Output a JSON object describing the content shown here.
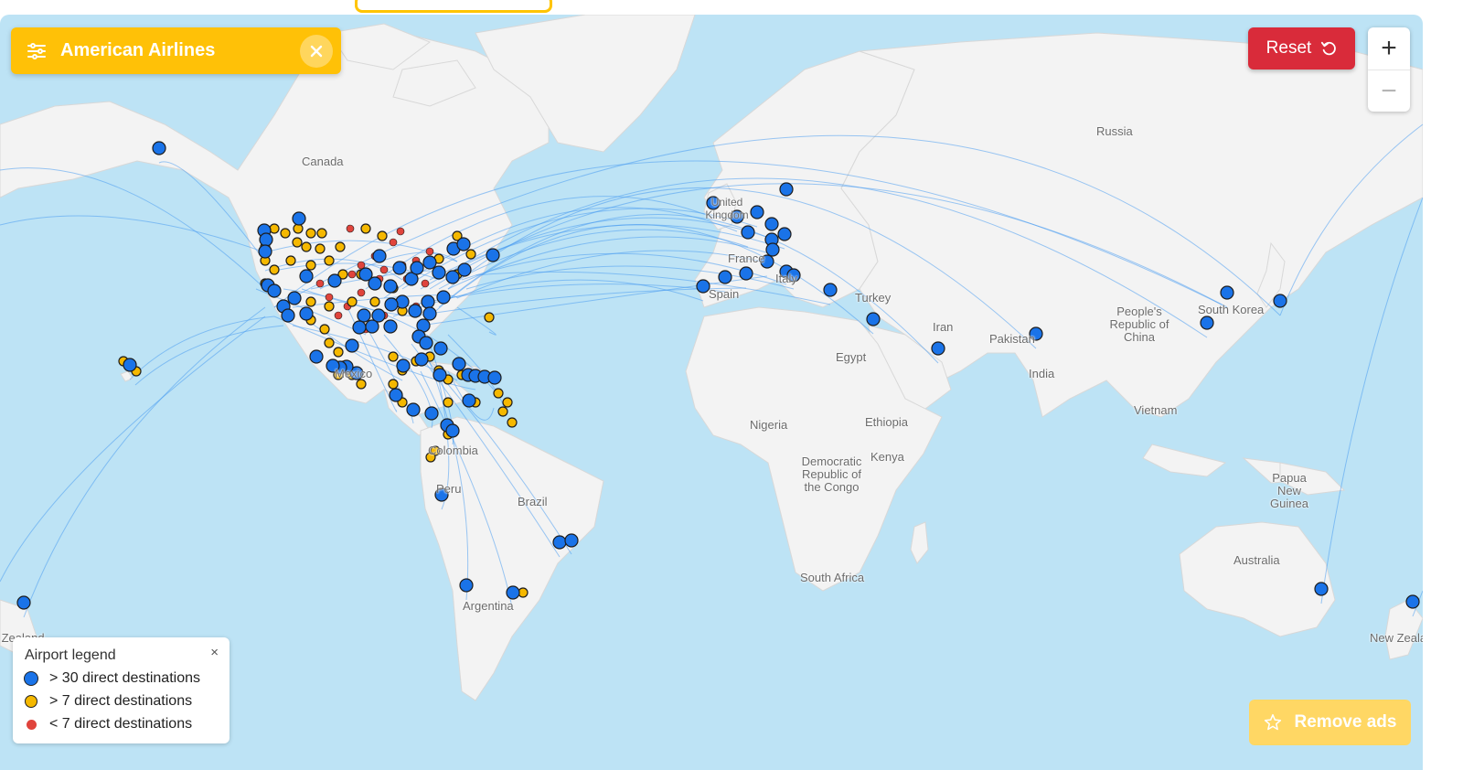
{
  "filter": {
    "airline": "American Airlines",
    "filter_icon": "sliders-icon",
    "clear_icon": "close-icon"
  },
  "controls": {
    "reset_label": "Reset",
    "reset_icon": "rotate-ccw-icon",
    "zoom_in_label": "+",
    "zoom_out_label": "−",
    "remove_ads_label": "Remove ads",
    "remove_ads_icon": "star-icon"
  },
  "legend": {
    "title": "Airport legend",
    "close_label": "×",
    "items": [
      {
        "label": "> 30 direct destinations",
        "color": "#1a73e8",
        "size": "large"
      },
      {
        "label": "> 7 direct destinations",
        "color": "#f5b800",
        "size": "medium"
      },
      {
        "label": "< 7 direct destinations",
        "color": "#e0443c",
        "size": "small"
      }
    ]
  },
  "map_labels": [
    "Canada",
    "Russia",
    "United Kingdom",
    "France",
    "Italy",
    "Spain",
    "Turkey",
    "Iran",
    "Pakistan",
    "People's Republic of China",
    "South Korea",
    "India",
    "Egypt",
    "Vietnam",
    "Nigeria",
    "Ethiopia",
    "Kenya",
    "Democratic Republic of the Congo",
    "Colombia",
    "Peru",
    "Brazil",
    "Argentina",
    "South Africa",
    "Australia",
    "Papua New Guinea",
    "New Zealand",
    "Mexico"
  ],
  "colors": {
    "ocean": "#bde3f5",
    "land": "#f2f2f2",
    "route": "#4a9df0",
    "brand_yellow": "#ffc107",
    "reset_red": "#d92b3a"
  }
}
